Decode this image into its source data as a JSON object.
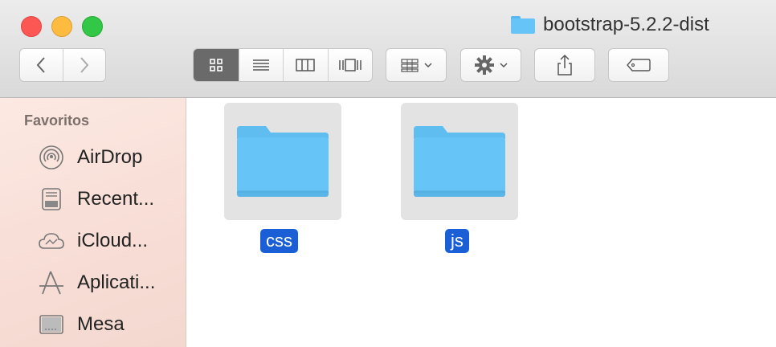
{
  "window": {
    "title": "bootstrap-5.2.2-dist"
  },
  "toolbar": {
    "back_icon": "chevron-left-icon",
    "forward_icon": "chevron-right-icon",
    "view_modes": [
      "icon-view",
      "list-view",
      "column-view",
      "gallery-view"
    ],
    "selected_view": "icon-view",
    "arrange_icon": "arrange-grid-icon",
    "action_icon": "gear-icon",
    "share_icon": "share-icon",
    "tag_icon": "tag-icon"
  },
  "sidebar": {
    "heading": "Favoritos",
    "items": [
      {
        "label": "AirDrop",
        "icon": "airdrop-icon"
      },
      {
        "label": "Recent...",
        "icon": "recents-icon"
      },
      {
        "label": "iCloud...",
        "icon": "icloud-icon"
      },
      {
        "label": "Aplicati...",
        "icon": "applications-icon"
      },
      {
        "label": "Mesa",
        "icon": "desktop-icon"
      }
    ]
  },
  "files": [
    {
      "name": "css",
      "type": "folder",
      "selected": true
    },
    {
      "name": "js",
      "type": "folder",
      "selected": true
    }
  ],
  "colors": {
    "folder": "#66c5f6",
    "selection": "#1a5fd6",
    "sidebar": "#fae3dc"
  }
}
